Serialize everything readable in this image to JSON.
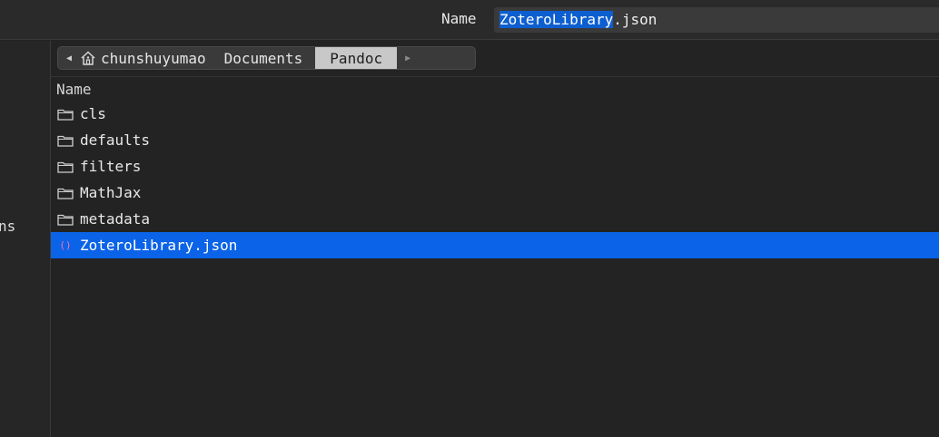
{
  "header": {
    "name_label": "Name",
    "filename_selected": "ZoteroLibrary",
    "filename_ext": ".json"
  },
  "sidebar": {
    "partial_label": "ns"
  },
  "pathbar": {
    "back_icon": "triangle-left-icon",
    "forward_icon": "triangle-right-icon",
    "segments": [
      {
        "label": "chunshuyumao",
        "icon": "home-icon"
      },
      {
        "label": "Documents"
      },
      {
        "label": "Pandoc"
      }
    ]
  },
  "list": {
    "column_header": "Name",
    "items": [
      {
        "label": "cls",
        "icon": "folder-icon"
      },
      {
        "label": "defaults",
        "icon": "folder-icon"
      },
      {
        "label": "filters",
        "icon": "folder-icon"
      },
      {
        "label": "MathJax",
        "icon": "folder-icon"
      },
      {
        "label": "metadata",
        "icon": "folder-icon"
      },
      {
        "label": "ZoteroLibrary.json",
        "icon": "json-file-icon"
      }
    ]
  },
  "colors": {
    "selection": "#0b63e8",
    "text_selection": "#0d5fd0",
    "json_icon": "#ff6fae"
  }
}
